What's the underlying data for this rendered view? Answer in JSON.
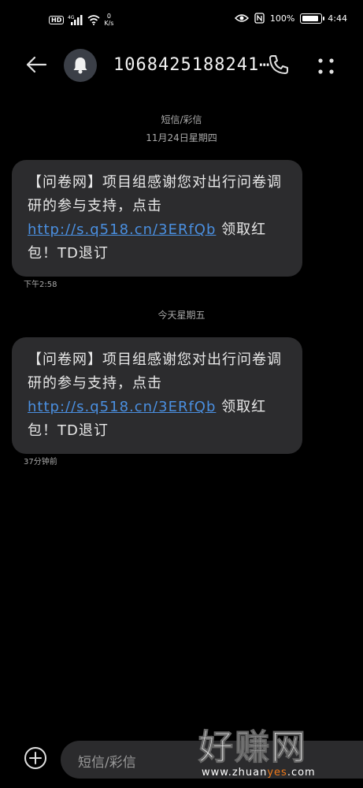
{
  "status_bar": {
    "hd": "HD",
    "network_speed": "0",
    "network_unit": "K/s",
    "battery_percent": "100%",
    "time": "4:44",
    "signal_label": "4G"
  },
  "header": {
    "title": "1068425188241⋯",
    "icons": [
      "back-arrow-icon",
      "bell-icon",
      "phone-icon",
      "more-vert-icon"
    ]
  },
  "thread": {
    "channel_label": "短信/彩信",
    "date_1": "11月24日星期四",
    "message_1": {
      "text_before": "【问卷网】项目组感谢您对出行问卷调研的参与支持，点击 ",
      "link": "http://s.q518.cn/3ERfQb",
      "text_after": " 领取红包！TD退订",
      "time": "下午2:58"
    },
    "date_2": "今天星期五",
    "message_2": {
      "text_before": "【问卷网】项目组感谢您对出行问卷调研的参与支持，点击 ",
      "link": "http://s.q518.cn/3ERfQb",
      "text_after": " 领取红包！TD退订",
      "time": "37分钟前"
    }
  },
  "composer": {
    "placeholder": "短信/彩信"
  },
  "watermark": {
    "big": "好赚网",
    "small_1": "www.zhuan",
    "small_2": "yes",
    "small_3": ".com"
  },
  "colors": {
    "background": "#000000",
    "bubble": "#2c2c2e",
    "link": "#4a8fe0"
  }
}
